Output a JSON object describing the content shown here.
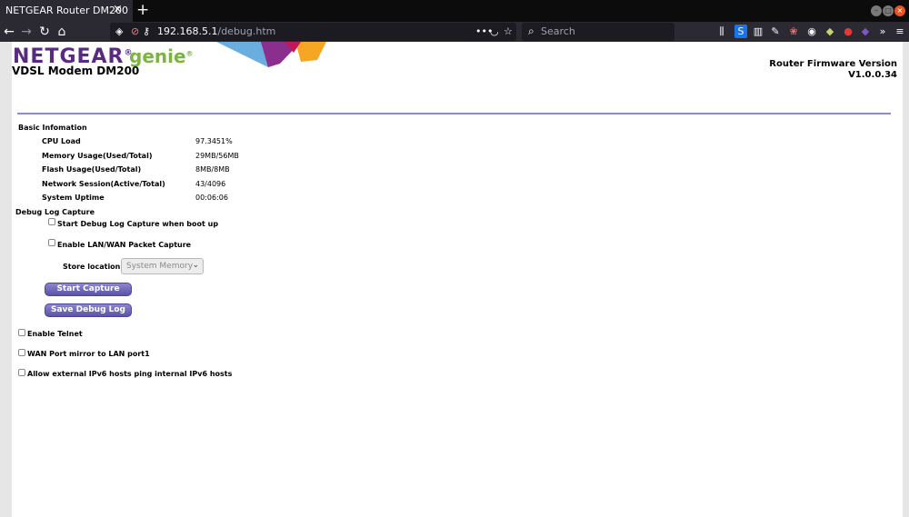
{
  "browser": {
    "tab_title": "NETGEAR Router DM200",
    "tab_close": "×",
    "new_tab": "+",
    "url_host": "192.168.5.1",
    "url_path": "/debug.htm",
    "page_actions": "•••",
    "search_placeholder": "Search"
  },
  "header": {
    "brand": "NETGEAR",
    "brand_reg": "®",
    "genie": "genie",
    "genie_reg": "®",
    "model": "VDSL Modem DM200",
    "fw_label": "Router Firmware Version",
    "fw_version": "V1.0.0.34"
  },
  "basic": {
    "title": "Basic Infomation",
    "rows": [
      {
        "label": "CPU Load",
        "value": "97.3451%"
      },
      {
        "label": "Memory Usage(Used/Total)",
        "value": "29MB/56MB"
      },
      {
        "label": "Flash Usage(Used/Total)",
        "value": "8MB/8MB"
      },
      {
        "label": "Network Session(Active/Total)",
        "value": "43/4096"
      },
      {
        "label": "System Uptime",
        "value": "00:06:06"
      }
    ]
  },
  "debug": {
    "title": "Debug Log Capture",
    "boot_capture_label": "Start Debug Log Capture when boot up",
    "packet_capture_label": "Enable LAN/WAN Packet Capture",
    "store_location_label": "Store location",
    "store_location_value": "System Memory",
    "start_capture": "Start Capture",
    "save_debug_log": "Save Debug Log"
  },
  "options": {
    "telnet": "Enable Telnet",
    "wan_mirror": "WAN Port mirror to LAN port1",
    "ipv6_ping": "Allow external IPv6 hosts ping internal IPv6 hosts"
  },
  "colors": {
    "accent_rule": "#8a8ad6",
    "button": "#6b64b8",
    "brand_purple": "#5a2a83",
    "genie_green": "#7cb342"
  }
}
